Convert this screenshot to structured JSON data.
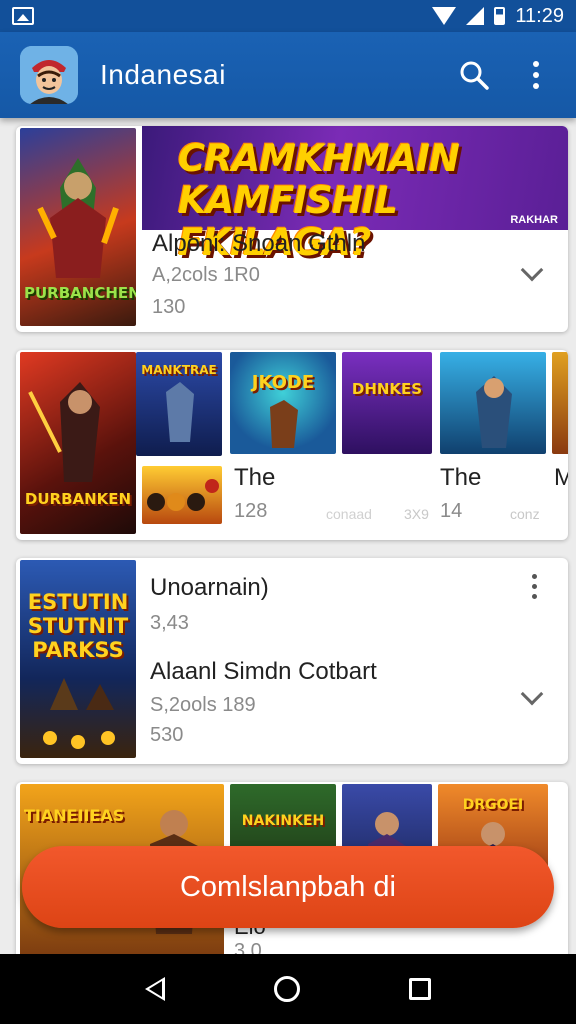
{
  "status_bar": {
    "time": "11:29"
  },
  "app_bar": {
    "title": "Indanesai",
    "search_icon": "search-icon",
    "menu_icon": "more-vert-icon"
  },
  "card1": {
    "cover_label": "PURBANCHEN",
    "banner_text_line1": "CRAMKHMAIN",
    "banner_text_line2": "KAMFISHIL FKILAGA?",
    "banner_badge": "RAKHAR",
    "title": "Alponi: Snoan Gthln",
    "meta1": "A,2cols  1R0",
    "meta2": "130"
  },
  "card2": {
    "cover_label": "DURBANKEN",
    "thumb_labels": [
      "MANKTRAE",
      "JKODE",
      "DHNKES"
    ],
    "item1_title": "The",
    "item1_meta": "128",
    "item1_meta_b": "conaad",
    "item2_title": "The",
    "item2_meta": "14",
    "item2_meta_a": "3X9",
    "item3_title": "M",
    "item3_meta": "conz"
  },
  "card3": {
    "cover_label": "ESTUTIN STUTNIT PARKSS",
    "title": "Unoarnain)",
    "meta1": "3,43",
    "title2": "Alaanl Simdn Cotbart",
    "meta2": "S,2ools  189",
    "meta3": "530"
  },
  "card4": {
    "cover_label": "TIANEIIEAS",
    "thumb_label": "NAKINKEH",
    "thumb_label_b": "DRGOEI",
    "title": "Elo",
    "meta": "3.0"
  },
  "fab": {
    "label": "Comlslanpbah di"
  }
}
